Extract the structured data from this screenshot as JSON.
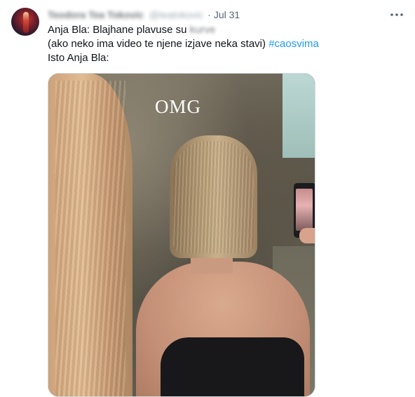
{
  "tweet": {
    "author_name": "Teodora Tea Tokovic",
    "author_handle": "@teatokovic",
    "separator": "·",
    "date": "Jul 31",
    "more_icon": "more-horizontal-icon",
    "text": {
      "line1_prefix": "Anja Bla: Blajhane plavuse su",
      "line1_blurred": "kurve",
      "line2_prefix": "(ako neko ima video te njene izjave neka stavi)",
      "hashtag": "#caosvima",
      "line3": "Isto Anja Bla:"
    },
    "media": {
      "overlay_text": "OMG"
    }
  },
  "colors": {
    "text": "#0f1419",
    "secondary": "#536471",
    "link": "#1d9bf0",
    "border": "#cfd9de"
  }
}
